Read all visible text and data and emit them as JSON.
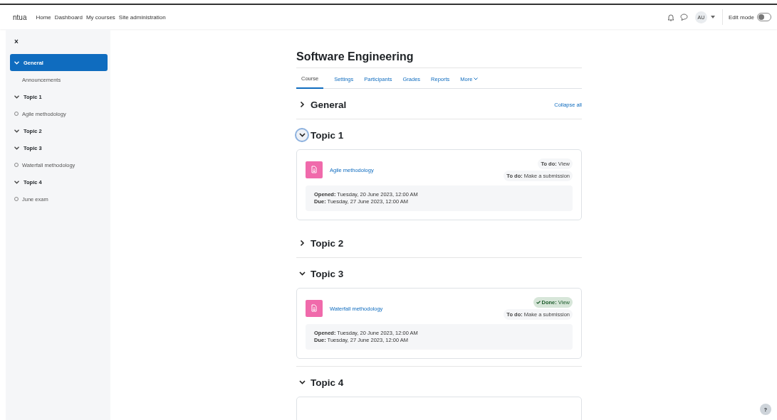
{
  "navbar": {
    "brand": "ntua",
    "links": [
      "Home",
      "Dashboard",
      "My courses",
      "Site administration"
    ],
    "avatar": "AU",
    "edit_mode": {
      "label": "Edit mode",
      "on": false
    }
  },
  "drawer": {
    "close": "×",
    "items": [
      {
        "kind": "section",
        "label": "General",
        "expanded": true,
        "selected": true
      },
      {
        "kind": "activity",
        "label": "Announcements",
        "marker": false
      },
      {
        "kind": "section",
        "label": "Topic 1",
        "expanded": true,
        "selected": false
      },
      {
        "kind": "activity",
        "label": "Agile methodology",
        "marker": true
      },
      {
        "kind": "section",
        "label": "Topic 2",
        "expanded": true,
        "selected": false
      },
      {
        "kind": "section",
        "label": "Topic 3",
        "expanded": true,
        "selected": false
      },
      {
        "kind": "activity",
        "label": "Waterfall methodology",
        "marker": true
      },
      {
        "kind": "section",
        "label": "Topic 4",
        "expanded": true,
        "selected": false
      },
      {
        "kind": "activity",
        "label": "June exam",
        "marker": true
      }
    ]
  },
  "course": {
    "title": "Software Engineering",
    "tabs": [
      {
        "label": "Course",
        "selected": true
      },
      {
        "label": "Settings",
        "selected": false
      },
      {
        "label": "Participants",
        "selected": false
      },
      {
        "label": "Grades",
        "selected": false
      },
      {
        "label": "Reports",
        "selected": false
      },
      {
        "label": "More",
        "selected": false
      }
    ],
    "collapse_all": "Collapse all",
    "sections": [
      {
        "title": "General",
        "expanded": false,
        "focused": false
      },
      {
        "title": "Topic 1",
        "expanded": true,
        "focused": true,
        "activities": [
          {
            "name": "Agile methodology",
            "completion": [
              {
                "kind": "todo",
                "label": "To do:",
                "value": "View"
              },
              {
                "kind": "todo",
                "label": "To do:",
                "value": "Make a submission"
              }
            ],
            "dates": [
              {
                "label": "Opened:",
                "value": "Tuesday, 20 June 2023, 12:00 AM"
              },
              {
                "label": "Due:",
                "value": "Tuesday, 27 June 2023, 12:00 AM"
              }
            ]
          }
        ]
      },
      {
        "title": "Topic 2",
        "expanded": false,
        "focused": false
      },
      {
        "title": "Topic 3",
        "expanded": true,
        "focused": false,
        "activities": [
          {
            "name": "Waterfall methodology",
            "completion": [
              {
                "kind": "done",
                "label": "Done:",
                "value": "View"
              },
              {
                "kind": "todo",
                "label": "To do:",
                "value": "Make a submission"
              }
            ],
            "dates": [
              {
                "label": "Opened:",
                "value": "Tuesday, 20 June 2023, 12:00 AM"
              },
              {
                "label": "Due:",
                "value": "Tuesday, 27 June 2023, 12:00 AM"
              }
            ]
          }
        ]
      },
      {
        "title": "Topic 4",
        "expanded": true,
        "focused": false
      }
    ]
  },
  "help": "?"
}
